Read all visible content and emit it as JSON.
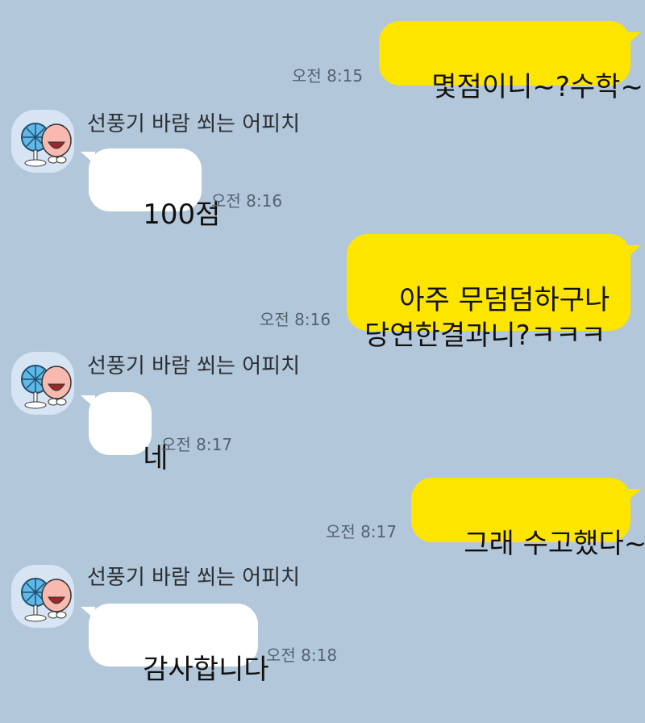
{
  "chat": {
    "sender_name": "선풍기 바람 쐬는 어피치",
    "avatar_icon": "apeach-fan-sticker-icon",
    "colors": {
      "background": "#b2c7da",
      "my_bubble": "#fee500",
      "other_bubble": "#ffffff"
    },
    "messages": [
      {
        "from": "me",
        "text": "몇점이니~?수학~!",
        "time": "오전 8:15"
      },
      {
        "from": "other",
        "text": "100점",
        "time": "오전 8:16"
      },
      {
        "from": "me",
        "text": "아주 무덤덤하구나\n당연한결과니?ㅋㅋㅋ",
        "time": "오전 8:16"
      },
      {
        "from": "other",
        "text": "네",
        "time": "오전 8:17"
      },
      {
        "from": "me",
        "text": "그래 수고했다~",
        "time": "오전 8:17"
      },
      {
        "from": "other",
        "text": "감사합니다",
        "time": "오전 8:18"
      }
    ]
  }
}
